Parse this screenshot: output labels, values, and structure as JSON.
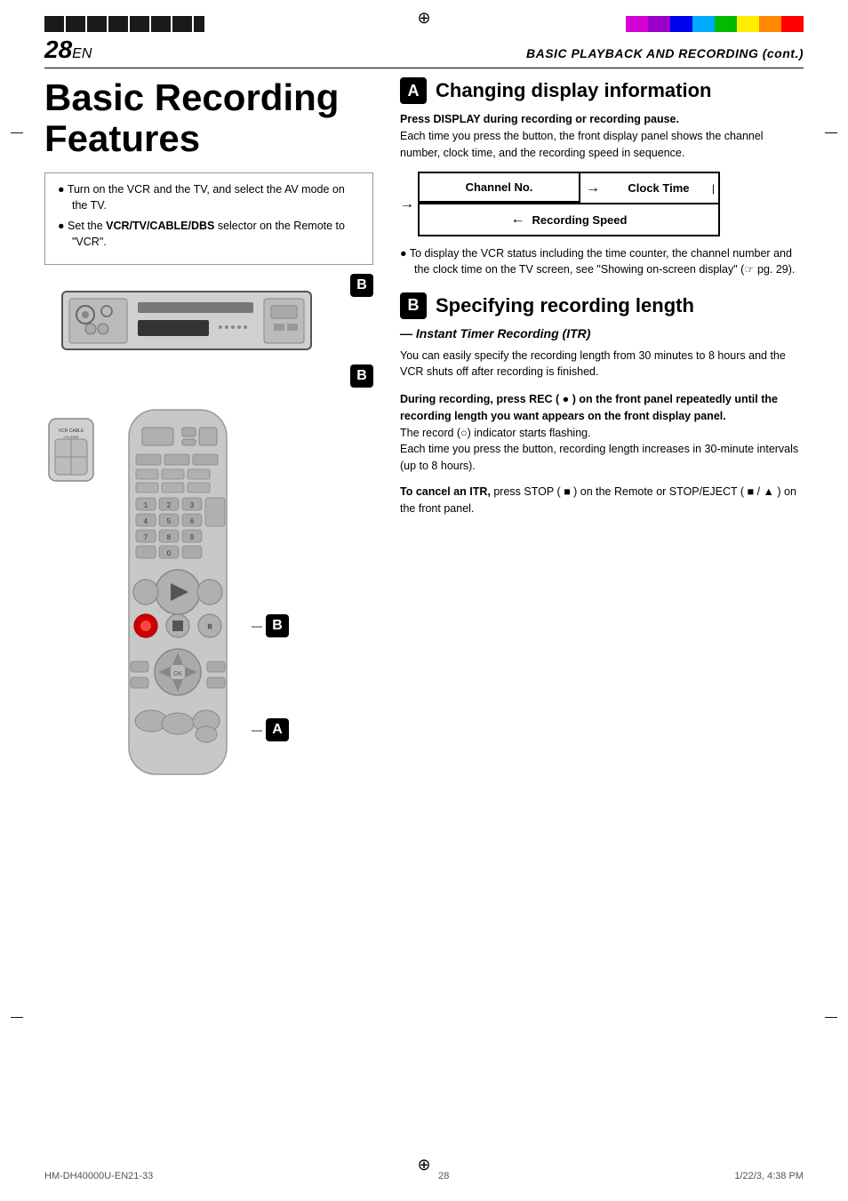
{
  "page": {
    "number": "28",
    "suffix": "EN",
    "header_title": "BASIC PLAYBACK AND RECORDING (cont.)",
    "footer_left": "HM-DH40000U-EN21-33",
    "footer_center": "28",
    "footer_right": "1/22/3, 4:38 PM"
  },
  "left_column": {
    "main_title": "Basic Recording Features",
    "bullet_list": [
      "Turn on the VCR and the TV, and select the AV mode on the TV.",
      "Set the VCR/TV/CABLE/DBS selector on the Remote to \"VCR\"."
    ],
    "bullet_bold_parts": [
      "VCR/TV/CABLE/DBS"
    ]
  },
  "right_column": {
    "section_a": {
      "badge": "A",
      "title": "Changing display information",
      "intro_bold": "Press DISPLAY during recording or recording pause.",
      "intro_text": "Each time you press the button, the front display panel shows the channel number, clock time, and the recording speed in sequence.",
      "diagram": {
        "cell_top_left": "Channel No.",
        "cell_top_right": "Clock Time",
        "cell_bottom": "Recording Speed"
      },
      "note": "To display the VCR status including the time counter, the channel number and the clock time on the TV screen, see \"Showing on-screen display\" (☞ pg. 29)."
    },
    "section_b": {
      "badge": "B",
      "title": "Specifying recording length",
      "subtitle": "— Instant Timer Recording (ITR)",
      "intro_text": "You can easily specify the recording length from 30 minutes to 8 hours and the VCR shuts off after recording is finished.",
      "instruction_bold": "During recording, press REC ( ● ) on the front panel repeatedly until the recording length you want appears on the front display panel.",
      "instruction_text1": "The record (○) indicator starts flashing.",
      "instruction_text2": "Each time you press the button, recording length increases in 30-minute intervals (up to 8 hours).",
      "cancel_bold": "To cancel an ITR,",
      "cancel_text": "press STOP ( ■ ) on the Remote or STOP/EJECT ( ■ / ▲ ) on the front panel."
    }
  },
  "badges": {
    "b_top": "B",
    "b_mid": "B",
    "b_bottom": "B",
    "a_bottom": "A"
  },
  "colors": {
    "top_bar_right": [
      "#f0c",
      "#c0f",
      "#00f",
      "#0af",
      "#0f0",
      "#ff0",
      "#f80",
      "#f00"
    ],
    "black": "#000000",
    "white": "#ffffff"
  }
}
